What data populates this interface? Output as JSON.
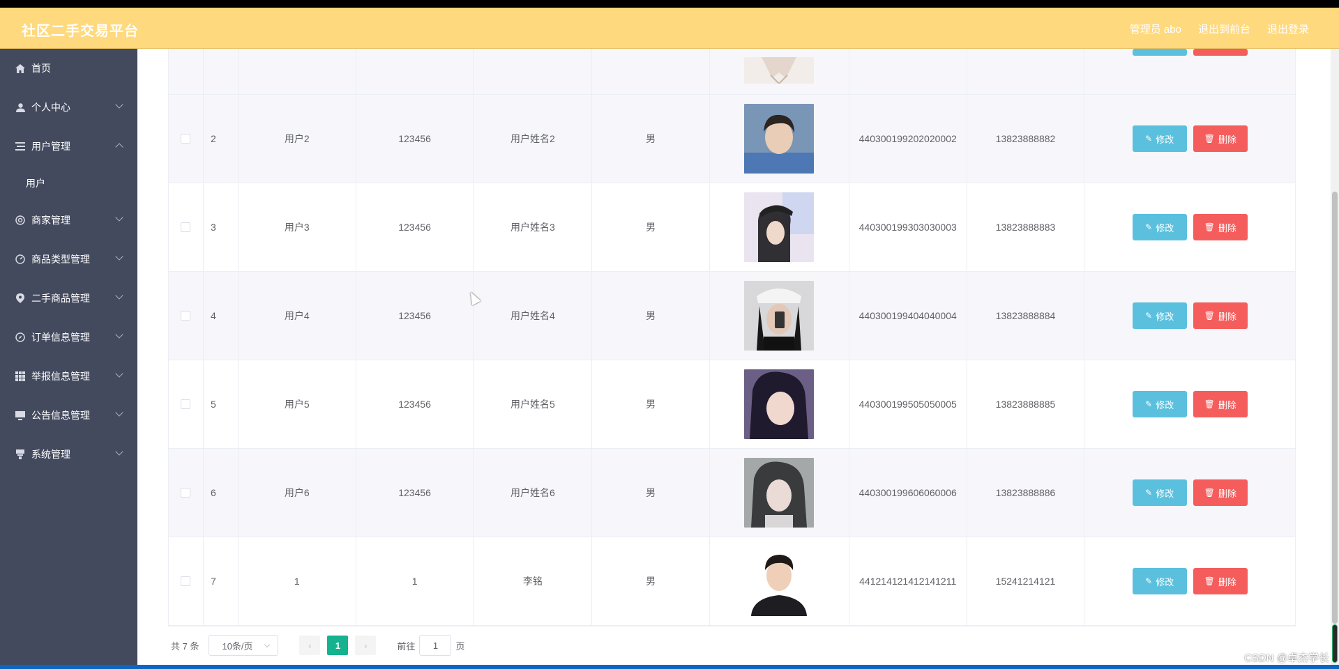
{
  "header": {
    "title": "社区二手交易平台",
    "admin_label": "管理员 abo",
    "front_link": "退出到前台",
    "logout_link": "退出登录"
  },
  "sidebar": {
    "items": [
      {
        "label": "首页",
        "icon": "home-icon",
        "expandable": false
      },
      {
        "label": "个人中心",
        "icon": "user-icon",
        "expandable": true,
        "expanded": false
      },
      {
        "label": "用户管理",
        "icon": "list-icon",
        "expandable": true,
        "expanded": true,
        "children": [
          "用户"
        ]
      },
      {
        "label": "商家管理",
        "icon": "shop-icon",
        "expandable": true,
        "expanded": false
      },
      {
        "label": "商品类型管理",
        "icon": "category-icon",
        "expandable": true,
        "expanded": false
      },
      {
        "label": "二手商品管理",
        "icon": "location-icon",
        "expandable": true,
        "expanded": false
      },
      {
        "label": "订单信息管理",
        "icon": "compass-icon",
        "expandable": true,
        "expanded": false
      },
      {
        "label": "举报信息管理",
        "icon": "grid-icon",
        "expandable": true,
        "expanded": false
      },
      {
        "label": "公告信息管理",
        "icon": "monitor-icon",
        "expandable": true,
        "expanded": false
      },
      {
        "label": "系统管理",
        "icon": "settings-icon",
        "expandable": true,
        "expanded": false
      }
    ]
  },
  "table": {
    "rows": [
      {
        "index": "2",
        "account": "用户2",
        "password": "123456",
        "name": "用户姓名2",
        "gender": "男",
        "id_number": "440300199202020002",
        "phone": "13823888882"
      },
      {
        "index": "3",
        "account": "用户3",
        "password": "123456",
        "name": "用户姓名3",
        "gender": "男",
        "id_number": "440300199303030003",
        "phone": "13823888883"
      },
      {
        "index": "4",
        "account": "用户4",
        "password": "123456",
        "name": "用户姓名4",
        "gender": "男",
        "id_number": "440300199404040004",
        "phone": "13823888884"
      },
      {
        "index": "5",
        "account": "用户5",
        "password": "123456",
        "name": "用户姓名5",
        "gender": "男",
        "id_number": "440300199505050005",
        "phone": "13823888885"
      },
      {
        "index": "6",
        "account": "用户6",
        "password": "123456",
        "name": "用户姓名6",
        "gender": "男",
        "id_number": "440300199606060006",
        "phone": "13823888886"
      },
      {
        "index": "7",
        "account": "1",
        "password": "1",
        "name": "李铭",
        "gender": "男",
        "id_number": "441214121412141211",
        "phone": "15241214121"
      }
    ],
    "edit_label": "修改",
    "delete_label": "删除"
  },
  "pagination": {
    "total": "共 7 条",
    "page_size": "10条/页",
    "current_page": "1",
    "goto_prefix": "前往",
    "goto_value": "1",
    "goto_suffix": "页"
  },
  "watermark": "CSDN @卓杰学长"
}
